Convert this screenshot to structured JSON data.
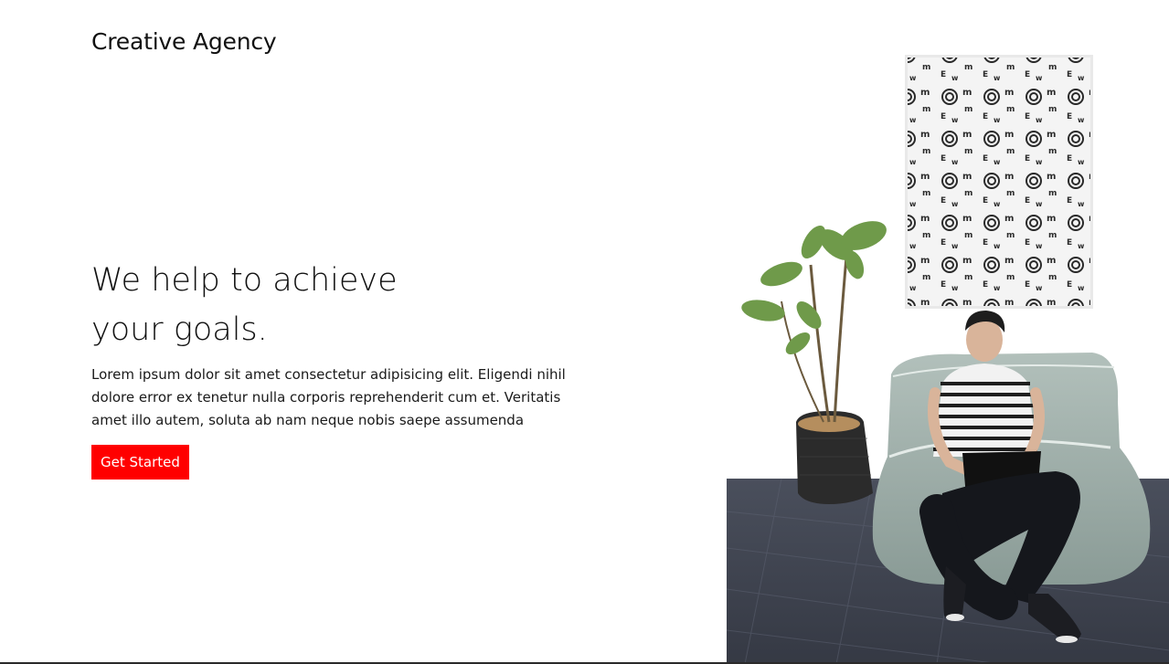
{
  "header": {
    "brand": "Creative Agency"
  },
  "hero": {
    "title_line_1": "We help to achieve",
    "title_line_2": "your goals.",
    "description_line_1": "Lorem ipsum dolor sit amet consectetur adipisicing elit. Eligendi nihil",
    "description_line_2": "dolore error ex tenetur nulla corporis reprehenderit cum et. Veritatis",
    "description_line_3": "amet illo autem, soluta ab nam neque nobis saepe assumenda",
    "cta_label": "Get Started"
  },
  "colors": {
    "accent": "#ff0000",
    "text": "#111111",
    "background": "#ffffff"
  }
}
